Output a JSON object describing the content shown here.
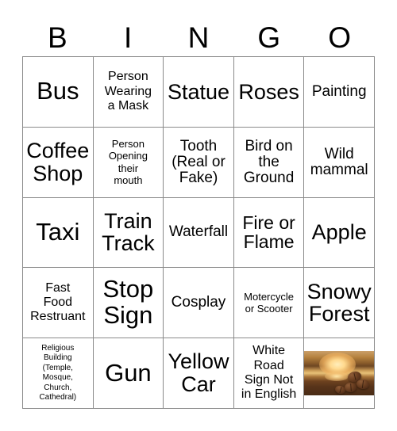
{
  "header": {
    "letters": [
      "B",
      "I",
      "N",
      "G",
      "O"
    ]
  },
  "colors": {
    "grid_line": "#8a8a8a",
    "text": "#000000",
    "background": "#ffffff"
  },
  "grid": {
    "rows": 5,
    "columns": 5,
    "cells": [
      {
        "text": "Bus",
        "size": "sz-xxl"
      },
      {
        "text": "Person\nWearing\na Mask",
        "size": "sz-sm"
      },
      {
        "text": "Statue",
        "size": "sz-xl"
      },
      {
        "text": "Roses",
        "size": "sz-xl"
      },
      {
        "text": "Painting",
        "size": "sz-md"
      },
      {
        "text": "Coffee\nShop",
        "size": "sz-xl"
      },
      {
        "text": "Person\nOpening\ntheir\nmouth",
        "size": "sz-xs"
      },
      {
        "text": "Tooth\n(Real or\nFake)",
        "size": "sz-md"
      },
      {
        "text": "Bird on\nthe\nGround",
        "size": "sz-md"
      },
      {
        "text": "Wild\nmammal",
        "size": "sz-md"
      },
      {
        "text": "Taxi",
        "size": "sz-xxl"
      },
      {
        "text": "Train\nTrack",
        "size": "sz-xl"
      },
      {
        "text": "Waterfall",
        "size": "sz-md"
      },
      {
        "text": "Fire or\nFlame",
        "size": "sz-lg"
      },
      {
        "text": "Apple",
        "size": "sz-xl"
      },
      {
        "text": "Fast\nFood\nRestruant",
        "size": "sz-sm"
      },
      {
        "text": "Stop\nSign",
        "size": "sz-xxl"
      },
      {
        "text": "Cosplay",
        "size": "sz-md"
      },
      {
        "text": "Motercycle\nor Scooter",
        "size": "sz-xs"
      },
      {
        "text": "Snowy\nForest",
        "size": "sz-xl"
      },
      {
        "text": "Religious\nBuilding\n(Temple,\nMosque,\nChurch,\nCathedral)",
        "size": "sz-xxs"
      },
      {
        "text": "Gun",
        "size": "sz-xxl"
      },
      {
        "text": "Yellow\nCar",
        "size": "sz-xl"
      },
      {
        "text": "White\nRoad\nSign Not\nin English",
        "size": "sz-sm"
      },
      {
        "text": "",
        "size": "sz-md",
        "image": "coffee-beans-sunset-photo"
      }
    ]
  }
}
